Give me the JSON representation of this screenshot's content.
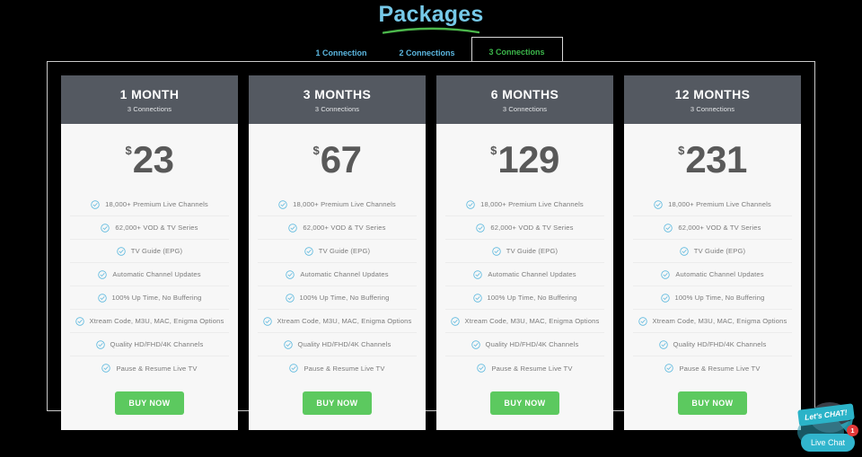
{
  "header": {
    "title": "Packages",
    "title_color": "#76c9e8",
    "underline_color": "#4cb84c"
  },
  "tabs": [
    {
      "label": "1 Connection",
      "active": false
    },
    {
      "label": "2 Connections",
      "active": false
    },
    {
      "label": "3 Connections",
      "active": true
    }
  ],
  "tab_colors": {
    "inactive_text": "#5bb7e0",
    "active_text": "#3bb54a",
    "active_border": "#d8d8d8"
  },
  "features": [
    "18,000+ Premium Live Channels",
    "62,000+ VOD & TV Series",
    "TV Guide (EPG)",
    "Automatic Channel Updates",
    "100% Up Time, No Buffering",
    "Xtream Code, M3U, MAC, Enigma Options",
    "Quality HD/FHD/4K Channels",
    "Pause & Resume Live TV"
  ],
  "buy_label": "BUY NOW",
  "currency_symbol": "$",
  "buy_button_color": "#5cc95f",
  "check_icon_color": "#5bb8de",
  "card_header_color": "#545961",
  "packages": [
    {
      "title": "1 MONTH",
      "subtitle": "3 Connections",
      "price": "23"
    },
    {
      "title": "3 MONTHS",
      "subtitle": "3 Connections",
      "price": "67"
    },
    {
      "title": "6 MONTHS",
      "subtitle": "3 Connections",
      "price": "129"
    },
    {
      "title": "12 MONTHS",
      "subtitle": "3 Connections",
      "price": "231"
    }
  ],
  "chat": {
    "bubble_label": "Let's CHAT!",
    "pill_label": "Live Chat",
    "badge_count": "1",
    "badge_color": "#e23a3a",
    "accent_color": "#31b5cd"
  }
}
